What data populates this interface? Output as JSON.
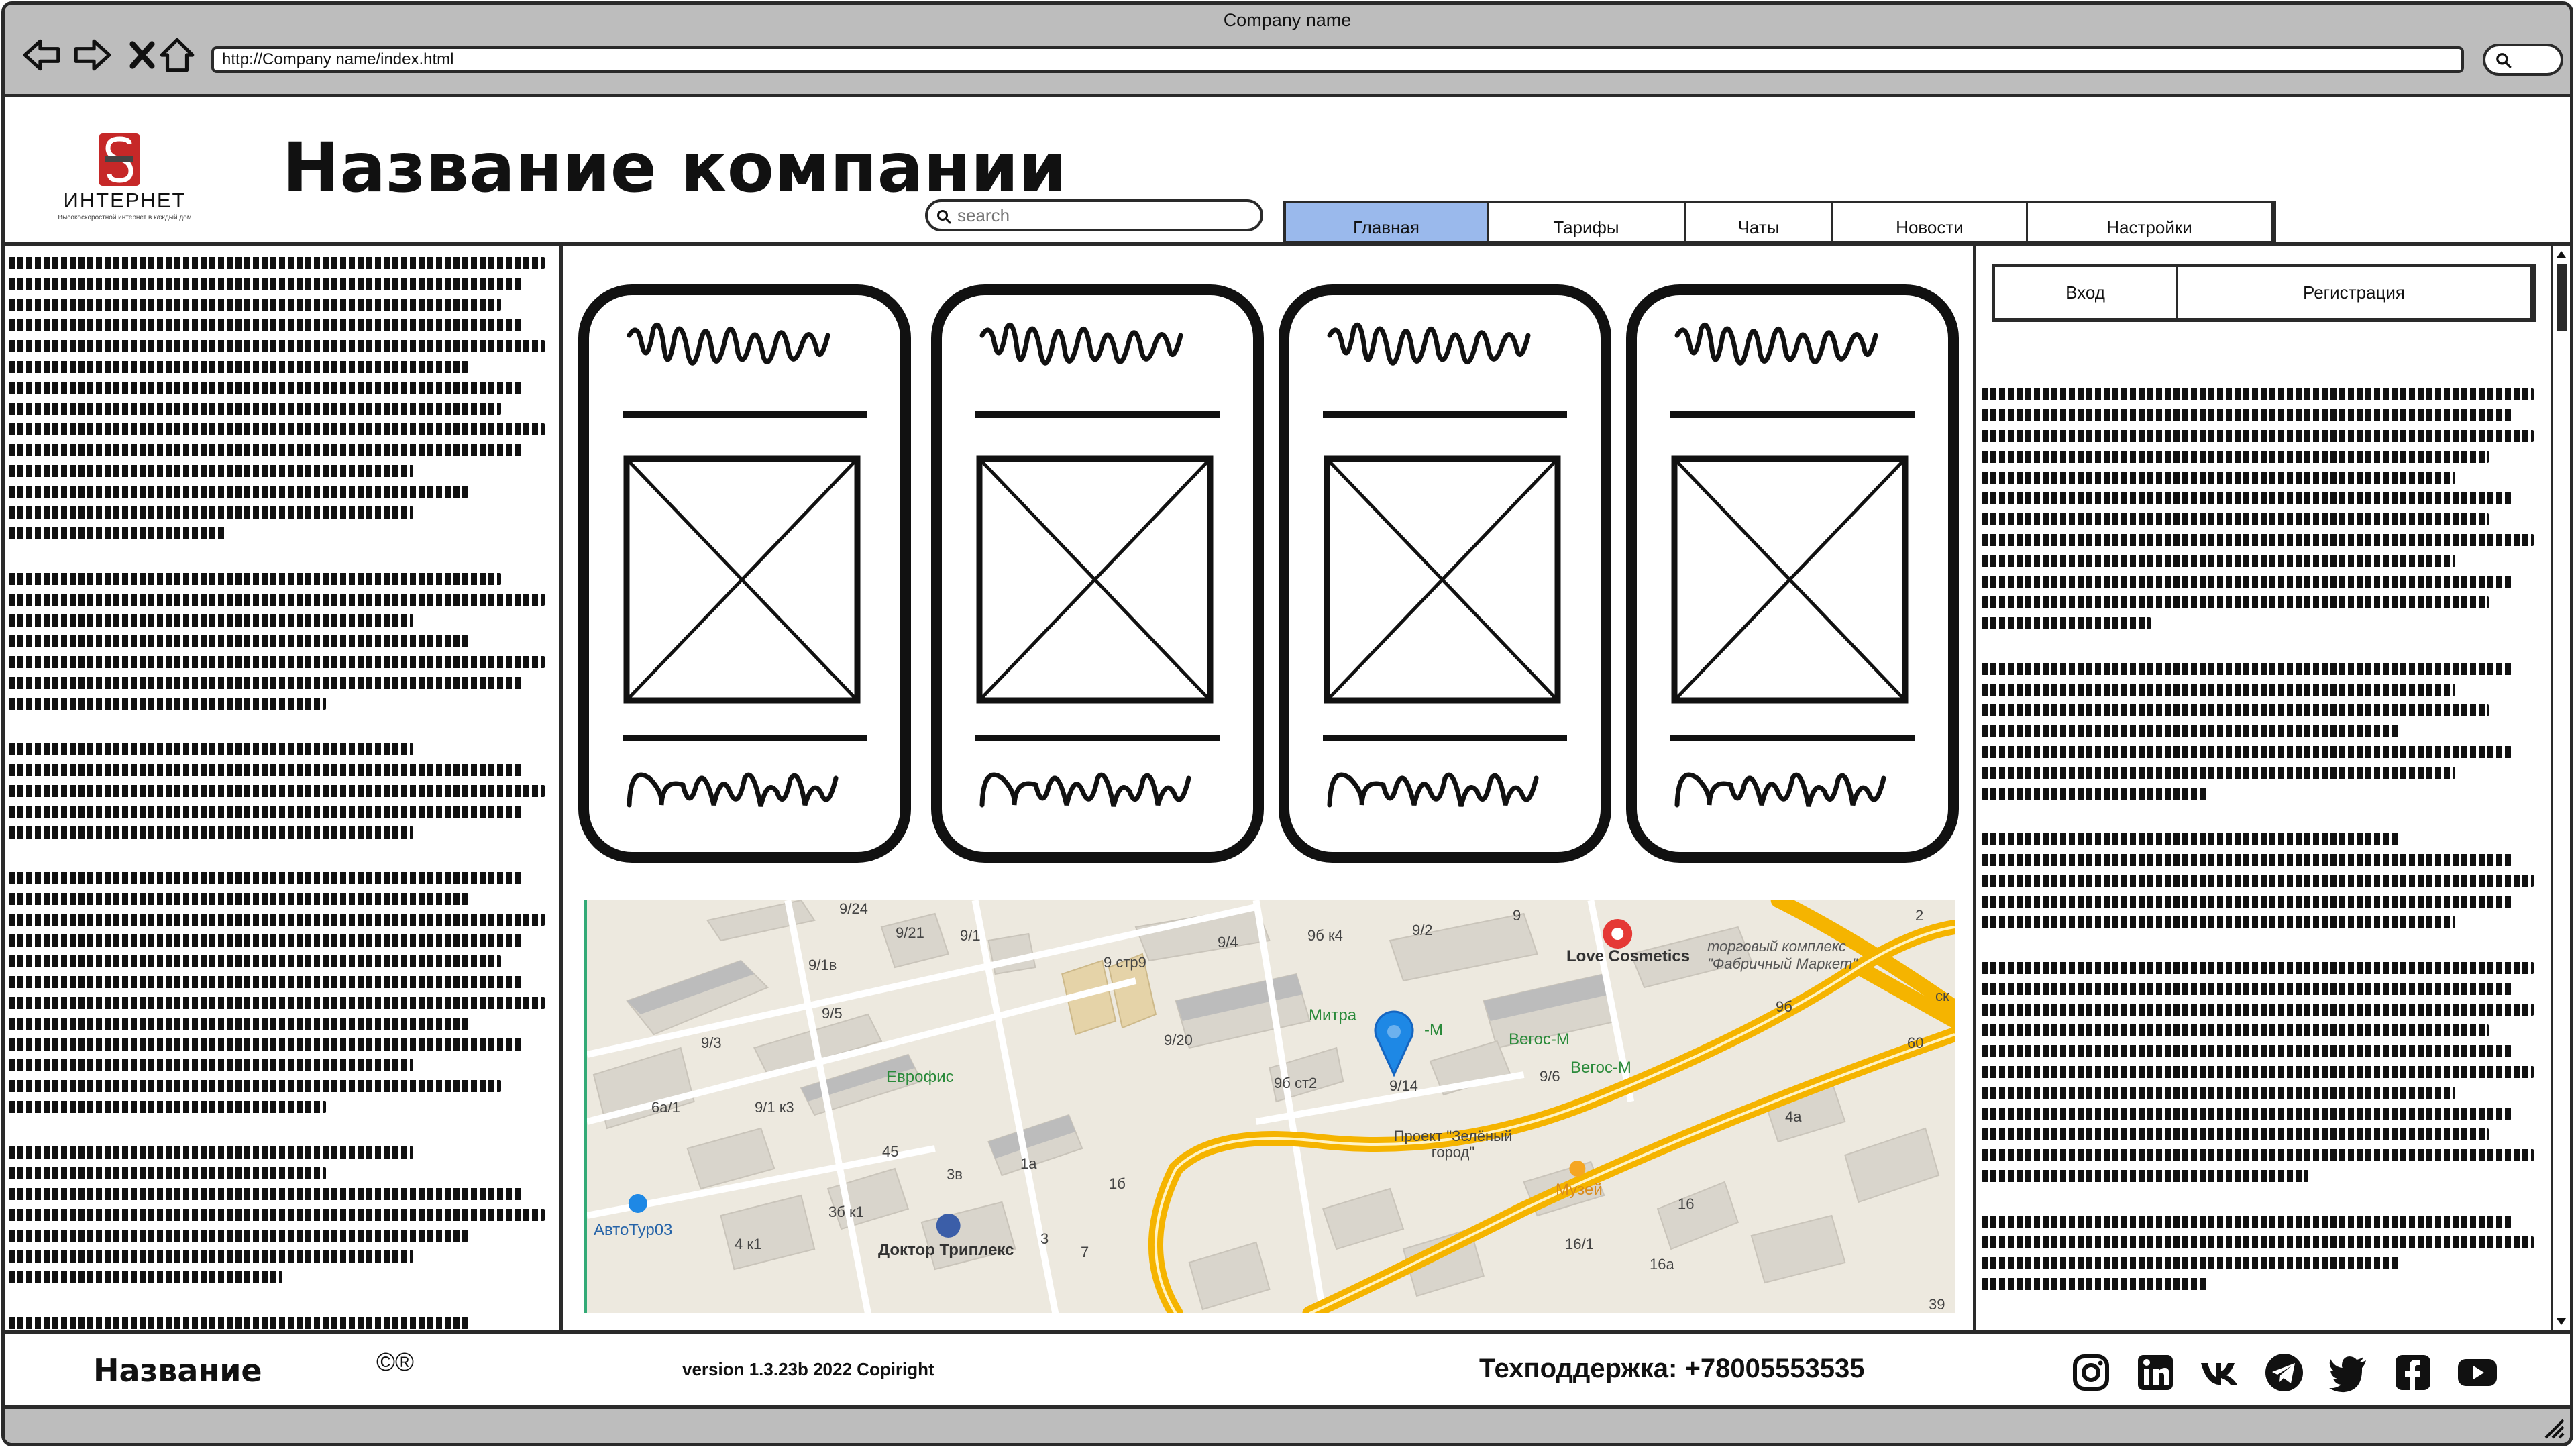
{
  "browser": {
    "window_title": "Company name",
    "url": "http://Company name/index.html"
  },
  "header": {
    "logo_text": "ИНТЕРНЕТ",
    "logo_tagline": "Высокоскоростной интернет в каждый дом",
    "title": "Название компании",
    "search_placeholder": "search"
  },
  "tabs": [
    {
      "label": "Главная",
      "active": true
    },
    {
      "label": "Тарифы",
      "active": false
    },
    {
      "label": "Чаты",
      "active": false
    },
    {
      "label": "Новости",
      "active": false
    },
    {
      "label": "Настройки",
      "active": false
    }
  ],
  "auth": {
    "login_label": "Вход",
    "register_label": "Регистрация"
  },
  "map": {
    "labels": [
      "9/24",
      "9/21",
      "9/1",
      "9/4",
      "9б к4",
      "9/2",
      "9",
      "9/1в",
      "9 стр9",
      "9/5",
      "9/3",
      "9/20",
      "9б ст2",
      "9/14",
      "9/6",
      "6а/1",
      "9/1 к3",
      "45",
      "3в",
      "1а",
      "1б",
      "3б к1",
      "4 к1",
      "3",
      "7",
      "16",
      "16/1",
      "16а",
      "4а",
      "39",
      "60",
      "9б",
      "2",
      "ск"
    ],
    "pois": {
      "love_cosmetics": "Love Cosmetics",
      "mall": "торговый комплекс \"Фабричный Маркет\"",
      "mitra": "Митра",
      "vegas_m1": "Вегос-М",
      "vegas_m2": "Вегос-М",
      "m_small": "-М",
      "evroofis": "Еврофис",
      "project": "Проект \"Зелёный город\"",
      "museum": "Музей",
      "avtotour": "АвтоТур03",
      "doktor": "Доктор Триплекс"
    }
  },
  "footer": {
    "name": "Название",
    "copyright": "©®",
    "version": "version 1.3.23b 2022 Copiright",
    "support": "Техподдержка: +78005553535"
  },
  "socials": [
    "instagram-icon",
    "linkedin-icon",
    "vk-icon",
    "telegram-icon",
    "twitter-icon",
    "facebook-icon",
    "youtube-icon"
  ],
  "colors": {
    "active_tab": "#9ab9ec",
    "chrome": "#bdbdbd",
    "map_road": "#f5b400",
    "map_pin": "#1e88e5",
    "logo_red": "#c62828"
  }
}
